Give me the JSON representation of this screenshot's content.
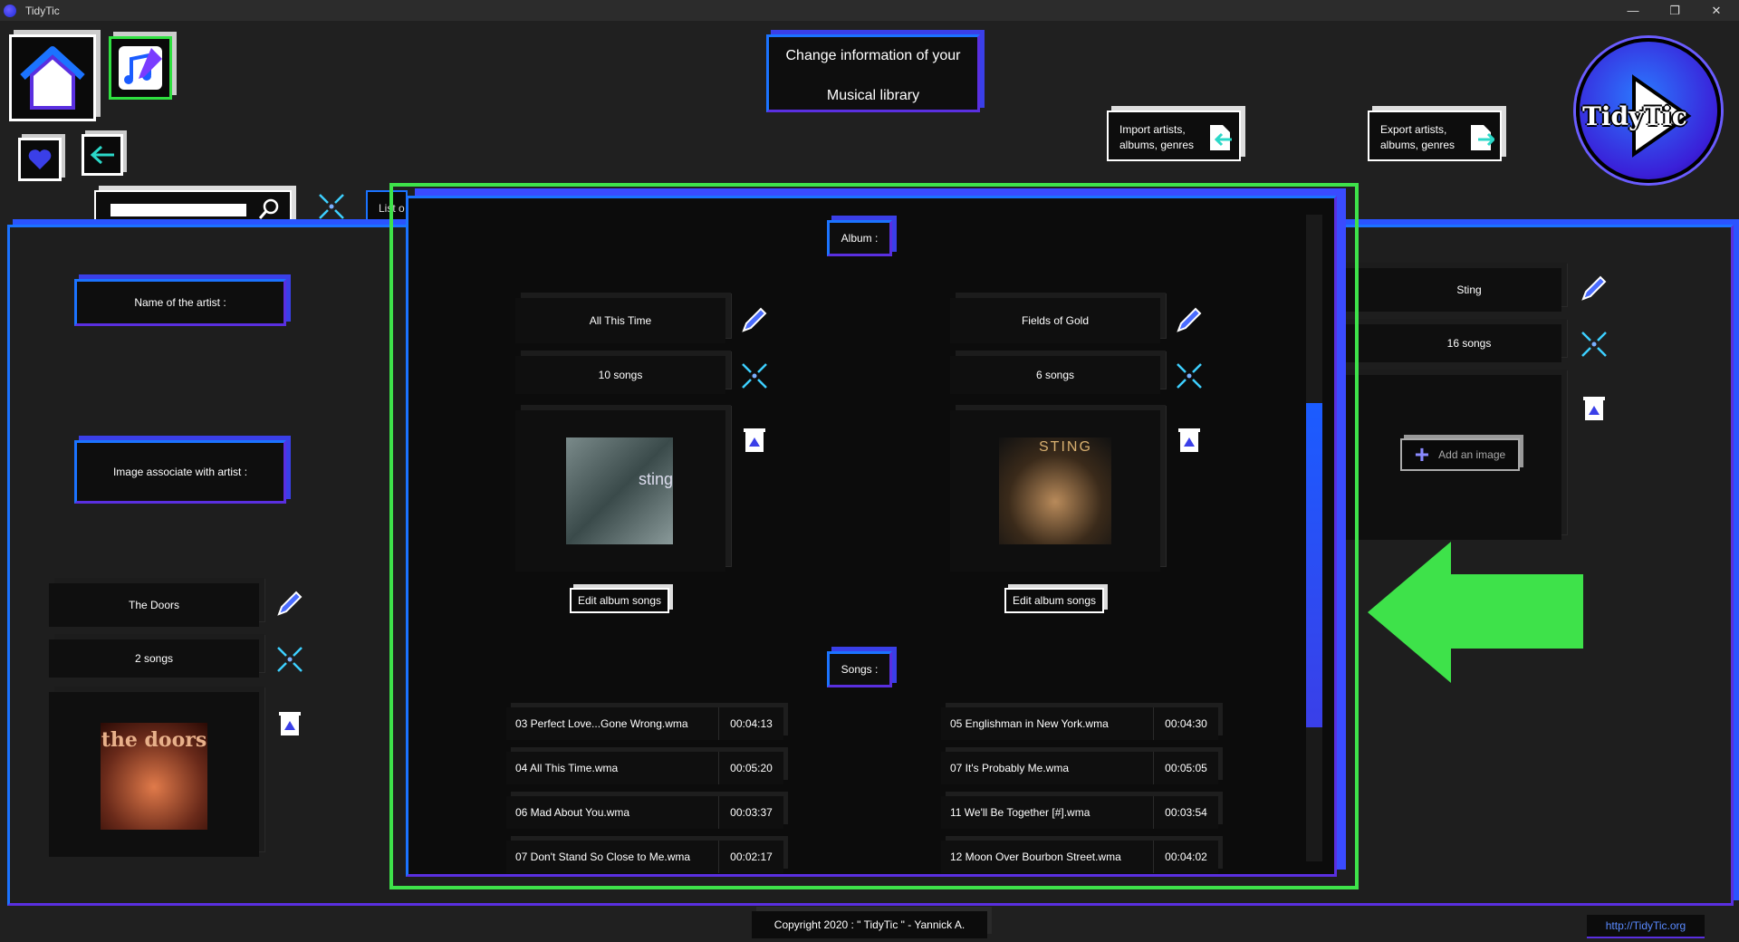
{
  "window": {
    "title": "TidyTic",
    "minimize": "—",
    "restore": "❐",
    "close": "✕"
  },
  "header": {
    "title_line1": "Change information of your",
    "title_line2": "Musical library",
    "import_line1": "Import artists,",
    "import_line2": "albums, genres",
    "export_line1": "Export artists,",
    "export_line2": "albums, genres",
    "logo_text": "TidyTic"
  },
  "search": {
    "placeholder": ""
  },
  "tab_partial": "List o",
  "left_panel": {
    "name_label": "Name of the artist :",
    "image_label": "Image associate with artist :",
    "artist_name": "The Doors",
    "artist_songs": "2 songs",
    "album_art_text": "the doors"
  },
  "album_panel": {
    "album_header": "Album :",
    "songs_header": "Songs :",
    "albums": [
      {
        "title": "All This Time",
        "songs": "10 songs",
        "edit_label": "Edit album songs",
        "art_text": "sting"
      },
      {
        "title": "Fields of Gold",
        "songs": "6 songs",
        "edit_label": "Edit album songs",
        "art_text": "STING"
      }
    ],
    "songs_left": [
      {
        "name": "03 Perfect Love...Gone Wrong.wma",
        "duration": "00:04:13"
      },
      {
        "name": "04 All This Time.wma",
        "duration": "00:05:20"
      },
      {
        "name": "06 Mad About You.wma",
        "duration": "00:03:37"
      },
      {
        "name": "07 Don't Stand So Close to Me.wma",
        "duration": "00:02:17"
      }
    ],
    "songs_right": [
      {
        "name": "05 Englishman in New York.wma",
        "duration": "00:04:30"
      },
      {
        "name": "07 It's Probably Me.wma",
        "duration": "00:05:05"
      },
      {
        "name": "11 We'll Be Together [#].wma",
        "duration": "00:03:54"
      },
      {
        "name": "12 Moon Over Bourbon Street.wma",
        "duration": "00:04:02"
      }
    ]
  },
  "right_panel": {
    "artist_name": "Sting",
    "artist_songs": "16 songs",
    "add_image": "Add an image"
  },
  "footer": {
    "copyright": "Copyright 2020 : \" TidyTic \" - Yannick A.",
    "link": "http://TidyTic.org"
  },
  "colors": {
    "accent_blue": "#1b73ff",
    "accent_purple": "#5a2fe0",
    "highlight_green": "#3ee24a"
  }
}
